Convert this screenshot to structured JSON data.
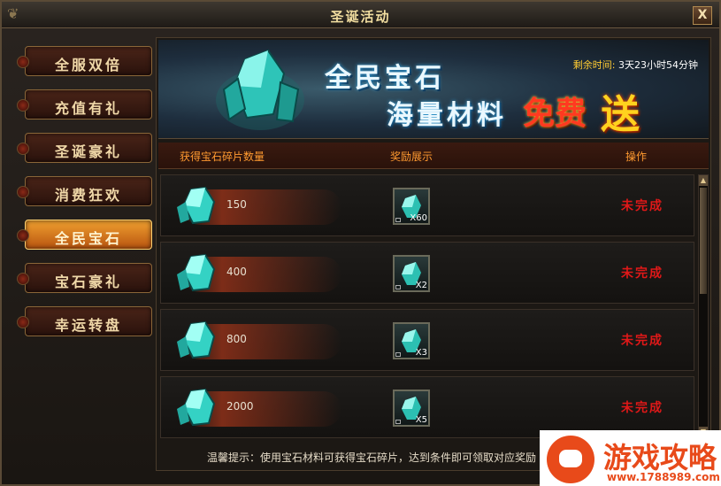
{
  "window": {
    "title": "圣诞活动",
    "close_label": "X"
  },
  "sidebar": {
    "items": [
      {
        "label": "全服双倍",
        "active": false
      },
      {
        "label": "充值有礼",
        "active": false
      },
      {
        "label": "圣诞豪礼",
        "active": false
      },
      {
        "label": "消费狂欢",
        "active": false
      },
      {
        "label": "全民宝石",
        "active": true
      },
      {
        "label": "宝石豪礼",
        "active": false
      },
      {
        "label": "幸运转盘",
        "active": false
      }
    ]
  },
  "banner": {
    "line1": "全民宝石",
    "line2": "海量材料",
    "free": "免费",
    "send": "送",
    "timer_label": "剩余时间:",
    "timer_value": "3天23小时54分钟"
  },
  "table": {
    "headers": {
      "count": "获得宝石碎片数量",
      "reward": "奖励展示",
      "action": "操作"
    },
    "rows": [
      {
        "count": "150",
        "qty": "X60",
        "status": "未完成"
      },
      {
        "count": "400",
        "qty": "X2",
        "status": "未完成"
      },
      {
        "count": "800",
        "qty": "X3",
        "status": "未完成"
      },
      {
        "count": "2000",
        "qty": "X5",
        "status": "未完成"
      }
    ]
  },
  "hint": "温馨提示：使用宝石材料可获得宝石碎片，达到条件即可领取对应奖励",
  "watermark": {
    "text": "游戏攻略",
    "url": "www.1788989.com"
  },
  "colors": {
    "accent": "#ff9a30",
    "status_red": "#e01818",
    "gem": "#3ad6c8"
  }
}
